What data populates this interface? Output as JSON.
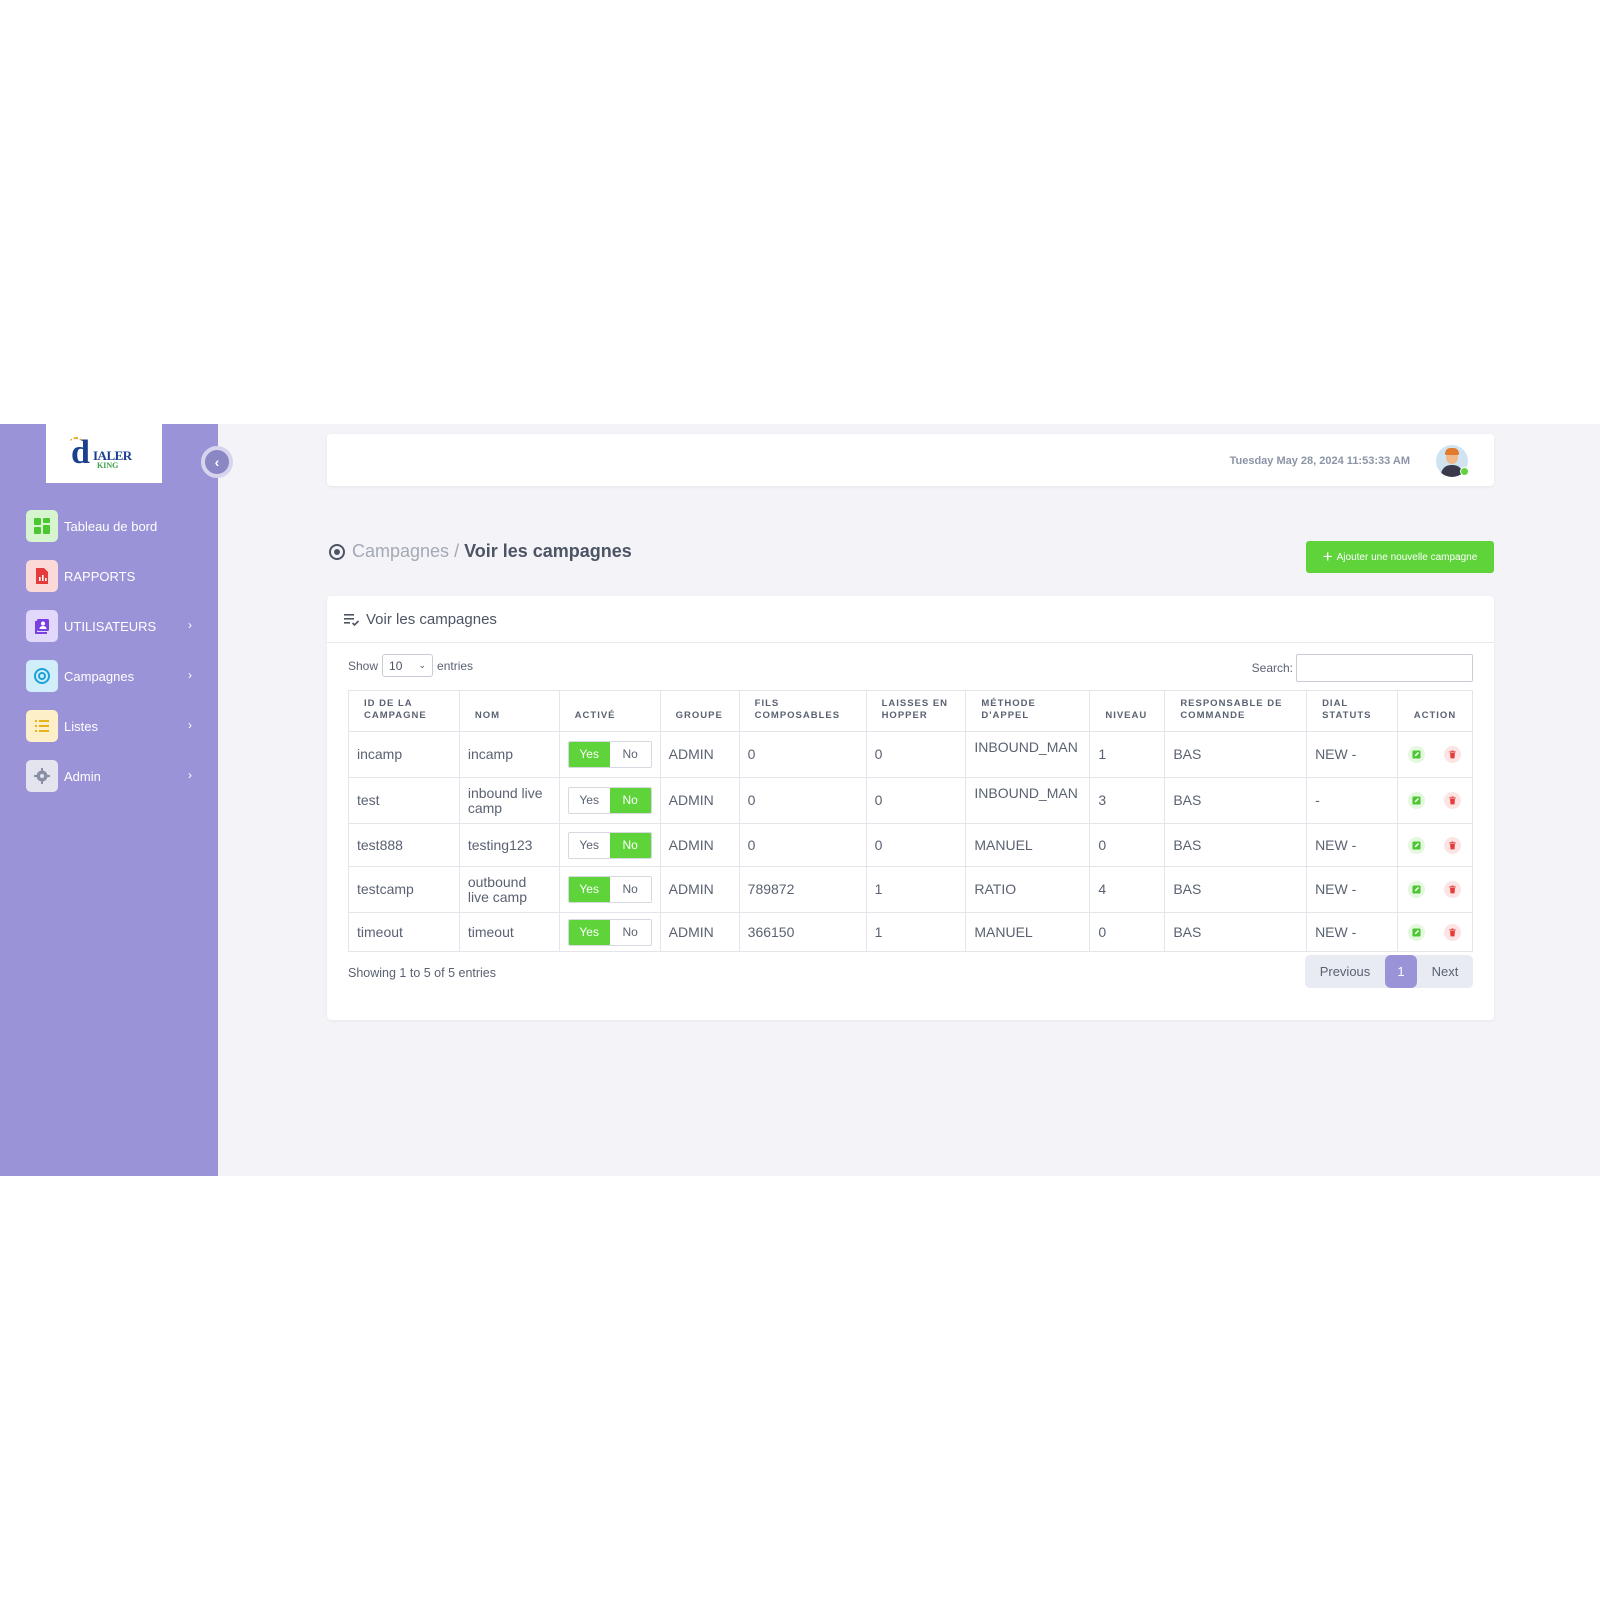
{
  "brand": {
    "logo_main": "IALER",
    "logo_sub": "KING"
  },
  "sidebar": {
    "items": [
      {
        "label": "Tableau de bord",
        "icon": "dashboard-icon",
        "has_submenu": false
      },
      {
        "label": "RAPPORTS",
        "icon": "report-icon",
        "has_submenu": false
      },
      {
        "label": "UTILISATEURS",
        "icon": "users-icon",
        "has_submenu": true
      },
      {
        "label": "Campagnes",
        "icon": "target-icon",
        "has_submenu": true
      },
      {
        "label": "Listes",
        "icon": "list-icon",
        "has_submenu": true
      },
      {
        "label": "Admin",
        "icon": "gear-icon",
        "has_submenu": true
      }
    ]
  },
  "topbar": {
    "datetime": "Tuesday May 28, 2024 11:53:33 AM"
  },
  "header": {
    "crumb_root": "Campagnes",
    "crumb_sep": "/",
    "crumb_current": "Voir les campagnes",
    "add_button": "Ajouter une nouvelle campagne"
  },
  "card": {
    "title": "Voir les campagnes",
    "show_label": "Show",
    "entries_label": "entries",
    "page_length": "10",
    "search_label": "Search:",
    "search_value": ""
  },
  "table": {
    "columns": [
      "ID de la campagne",
      "Nom",
      "Activé",
      "Groupe",
      "Fils composables",
      "Laisses en hopper",
      "Méthode d'appel",
      "Niveau",
      "Responsable de commande",
      "Dial statuts",
      "Action"
    ],
    "rows": [
      {
        "id": "incamp",
        "nom": "incamp",
        "active": "Yes",
        "groupe": "ADMIN",
        "fils": "0",
        "hopper": "0",
        "methode": "INBOUND_MAN",
        "niveau": "1",
        "responsable": "BAS",
        "statuts": "NEW -"
      },
      {
        "id": "test",
        "nom": "inbound live camp",
        "active": "No",
        "groupe": "ADMIN",
        "fils": "0",
        "hopper": "0",
        "methode": "INBOUND_MAN",
        "niveau": "3",
        "responsable": "BAS",
        "statuts": "-"
      },
      {
        "id": "test888",
        "nom": "testing123",
        "active": "No",
        "groupe": "ADMIN",
        "fils": "0",
        "hopper": "0",
        "methode": "MANUEL",
        "niveau": "0",
        "responsable": "BAS",
        "statuts": "NEW -"
      },
      {
        "id": "testcamp",
        "nom": "outbound live camp",
        "active": "Yes",
        "groupe": "ADMIN",
        "fils": "789872",
        "hopper": "1",
        "methode": "RATIO",
        "niveau": "4",
        "responsable": "BAS",
        "statuts": "NEW -"
      },
      {
        "id": "timeout",
        "nom": "timeout",
        "active": "Yes",
        "groupe": "ADMIN",
        "fils": "366150",
        "hopper": "1",
        "methode": "MANUEL",
        "niveau": "0",
        "responsable": "BAS",
        "statuts": "NEW -"
      }
    ],
    "yes_label": "Yes",
    "no_label": "No"
  },
  "footer": {
    "info": "Showing 1 to 5 of 5 entries",
    "prev": "Previous",
    "page": "1",
    "next": "Next"
  },
  "colors": {
    "sidebar": "#9a93d8",
    "accent_green": "#5ed43a",
    "pager_active": "#9a93d8"
  }
}
